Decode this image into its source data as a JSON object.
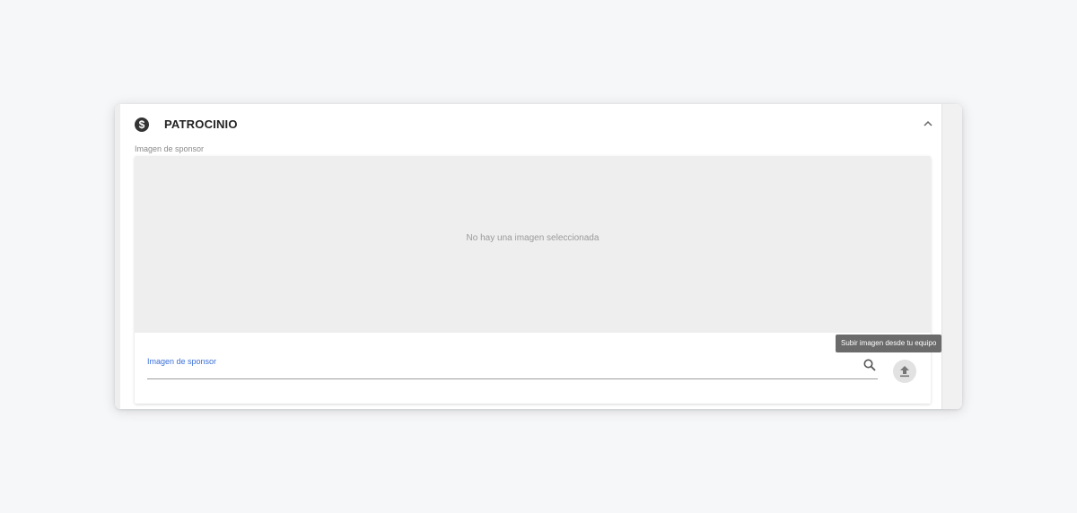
{
  "section": {
    "title": "PATROCINIO",
    "icon": "dollar-circle-icon",
    "collapse_icon": "chevron-up-icon"
  },
  "image_field": {
    "label": "Imagen de sponsor",
    "empty_text": "No hay una imagen seleccionada",
    "input_label": "Imagen de sponsor",
    "search_icon": "search-icon",
    "upload_icon": "upload-icon",
    "upload_tooltip": "Subir imagen desde tu equipo"
  },
  "colors": {
    "accent": "#3a6fd8",
    "preview_background": "#eeeeee",
    "tooltip_background": "#6b6b6b"
  }
}
